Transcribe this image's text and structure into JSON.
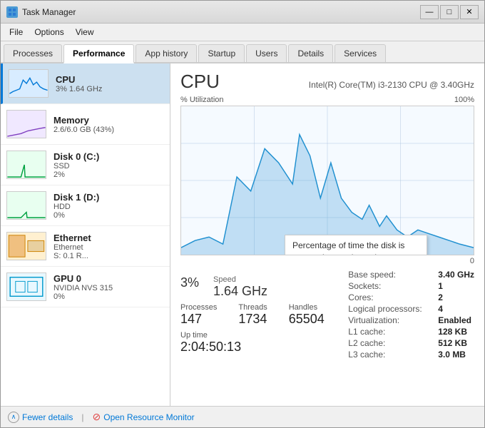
{
  "window": {
    "title": "Task Manager",
    "min_btn": "—",
    "max_btn": "□",
    "close_btn": "✕"
  },
  "menu": {
    "items": [
      "File",
      "Options",
      "View"
    ]
  },
  "tabs": [
    {
      "label": "Processes",
      "active": false
    },
    {
      "label": "Performance",
      "active": true
    },
    {
      "label": "App history",
      "active": false
    },
    {
      "label": "Startup",
      "active": false
    },
    {
      "label": "Users",
      "active": false
    },
    {
      "label": "Details",
      "active": false
    },
    {
      "label": "Services",
      "active": false
    }
  ],
  "sidebar": {
    "items": [
      {
        "id": "cpu",
        "name": "CPU",
        "detail1": "3%  1.64 GHz",
        "active": true
      },
      {
        "id": "memory",
        "name": "Memory",
        "detail1": "2.6/6.0 GB (43%)",
        "active": false
      },
      {
        "id": "disk0",
        "name": "Disk 0 (C:)",
        "detail1": "SSD",
        "detail2": "2%",
        "active": false
      },
      {
        "id": "disk1",
        "name": "Disk 1 (D:)",
        "detail1": "HDD",
        "detail2": "0%",
        "active": false
      },
      {
        "id": "ethernet",
        "name": "Ethernet",
        "detail1": "Ethernet",
        "detail2": "S: 0.1 R...",
        "active": false
      },
      {
        "id": "gpu",
        "name": "GPU 0",
        "detail1": "NVIDIA NVS 315",
        "detail2": "0%",
        "active": false
      }
    ]
  },
  "main": {
    "cpu_title": "CPU",
    "cpu_model": "Intel(R) Core(TM) i3-2130 CPU @ 3.40GHz",
    "chart_label_left": "% Utilization",
    "chart_label_right": "100%",
    "chart_label_bottom_right": "0",
    "util_label": "",
    "util_value": "3%",
    "speed_label": "Speed",
    "speed_value": "1.64 GHz",
    "processes_label": "Processes",
    "processes_value": "147",
    "threads_label": "Threads",
    "threads_value": "1734",
    "handles_label": "Handles",
    "handles_value": "65504",
    "uptime_label": "Up time",
    "uptime_value": "2:04:50:13",
    "info": {
      "base_speed_label": "Base speed:",
      "base_speed_value": "3.40 GHz",
      "sockets_label": "Sockets:",
      "sockets_value": "1",
      "cores_label": "Cores:",
      "cores_value": "2",
      "logical_label": "Logical processors:",
      "logical_value": "4",
      "virt_label": "Virtualization:",
      "virt_value": "Enabled",
      "l1_label": "L1 cache:",
      "l1_value": "128 KB",
      "l2_label": "L2 cache:",
      "l2_value": "512 KB",
      "l3_label": "L3 cache:",
      "l3_value": "3.0 MB"
    }
  },
  "tooltip": {
    "text": "Percentage of time the disk is processing read or write requests"
  },
  "footer": {
    "fewer_details": "Fewer details",
    "divider": "|",
    "resource_monitor": "Open Resource Monitor"
  }
}
